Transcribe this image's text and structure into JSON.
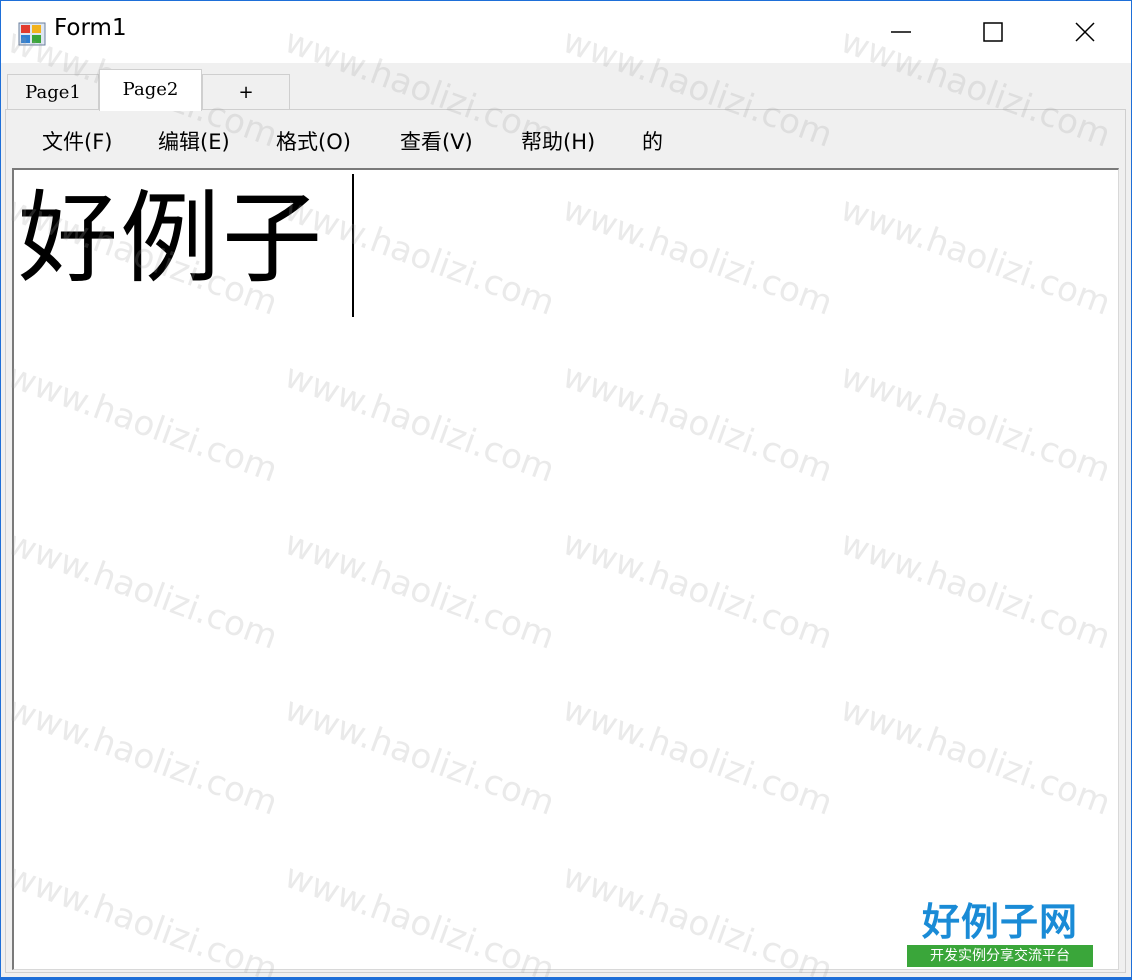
{
  "window": {
    "title": "Form1"
  },
  "tabs": [
    {
      "label": "Page1"
    },
    {
      "label": "Page2"
    },
    {
      "label": "+"
    }
  ],
  "menu": [
    {
      "label": "文件(F)"
    },
    {
      "label": "编辑(E)"
    },
    {
      "label": "格式(O)"
    },
    {
      "label": "查看(V)"
    },
    {
      "label": "帮助(H)"
    },
    {
      "label": "的"
    }
  ],
  "editor": {
    "text": "好例子"
  },
  "watermark": {
    "text": "www.haolizi.com"
  },
  "logo": {
    "main": "好例子网",
    "sub": "开发实例分享交流平台"
  },
  "colors": {
    "accent": "#1e6fd8",
    "logo_blue": "#1a8bd6",
    "logo_green": "#3aa63a"
  }
}
